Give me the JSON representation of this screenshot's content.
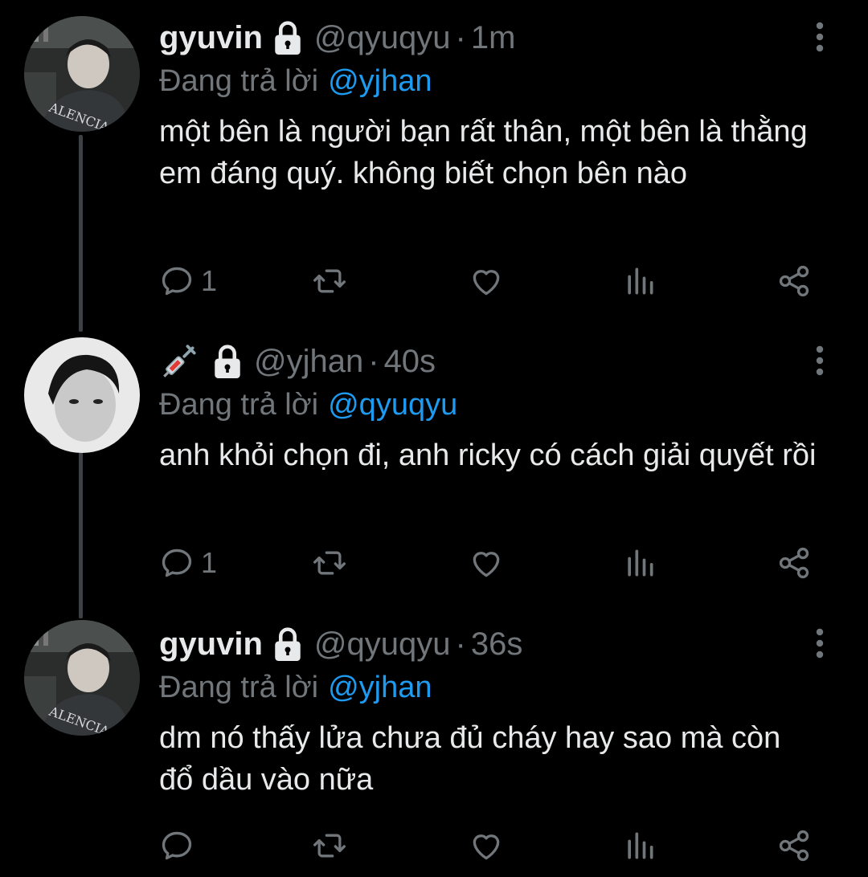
{
  "tweets": [
    {
      "name": "gyuvin",
      "handle": "@qyuqyu",
      "time": "1m",
      "reply_prefix": "Đang trả lời",
      "reply_to": "@yjhan",
      "text": "một bên là người bạn rất thân, một bên là thằng em đáng quý. không biết chọn bên nào",
      "reply_count": "1"
    },
    {
      "name": "",
      "handle": "@yjhan",
      "time": "40s",
      "reply_prefix": "Đang trả lời",
      "reply_to": "@qyuqyu",
      "text": "anh khỏi chọn đi, anh ricky có cách giải quyết rồi",
      "reply_count": "1"
    },
    {
      "name": "gyuvin",
      "handle": "@qyuqyu",
      "time": "36s",
      "reply_prefix": "Đang trả lời",
      "reply_to": "@yjhan",
      "text": "dm nó thấy lửa chưa đủ cháy hay sao mà còn đổ dầu vào nữa",
      "reply_count": ""
    }
  ],
  "separator": "·",
  "icons": {
    "lock": "lock-icon",
    "more": "more-vertical-icon",
    "reply": "reply-icon",
    "retweet": "retweet-icon",
    "like": "heart-icon",
    "views": "views-icon",
    "share": "share-icon",
    "emoji": "syringe-icon"
  },
  "colors": {
    "background": "#000000",
    "text": "#e7e9ea",
    "muted": "#71767b",
    "mention": "#1d9bf0",
    "thread_line": "#3d4145"
  }
}
